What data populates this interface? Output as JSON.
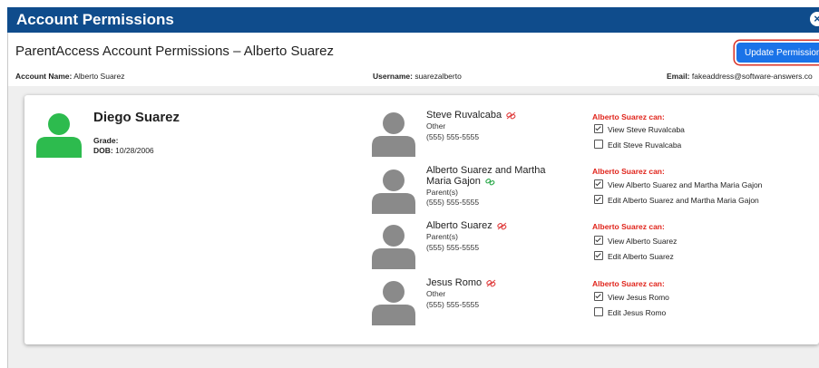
{
  "window": {
    "title": "Account Permissions"
  },
  "header": {
    "account_title": "ParentAccess Account Permissions – Alberto Suarez",
    "update_button_label": "Update Permissions"
  },
  "account_info": {
    "account_name_label": "Account Name:",
    "account_name_value": "Alberto Suarez",
    "username_label": "Username:",
    "username_value": "suarezalberto",
    "email_label": "Email:",
    "email_value": "fakeaddress@software-answers.co"
  },
  "student": {
    "name": "Diego Suarez",
    "grade_label": "Grade:",
    "grade_value": "",
    "dob_label": "DOB:",
    "dob_value": "10/28/2006"
  },
  "guardians": [
    {
      "name_line1": "Steve Ruvalcaba",
      "name_line2": "",
      "relationship": "Other",
      "phone": "(555) 555-5555",
      "link_icon": "unlinked-icon",
      "can_label": "Alberto Suarez can:",
      "view_label": "View Steve Ruvalcaba",
      "view_checked": true,
      "edit_label": "Edit Steve Ruvalcaba",
      "edit_checked": false
    },
    {
      "name_line1": "Alberto Suarez and Martha",
      "name_line2": "Maria Gajon",
      "relationship": "Parent(s)",
      "phone": "(555) 555-5555",
      "link_icon": "linked-icon",
      "can_label": "Alberto Suarez can:",
      "view_label": "View Alberto Suarez and Martha Maria Gajon",
      "view_checked": true,
      "edit_label": "Edit Alberto Suarez and Martha Maria Gajon",
      "edit_checked": true
    },
    {
      "name_line1": "Alberto Suarez",
      "name_line2": "",
      "relationship": "Parent(s)",
      "phone": "(555) 555-5555",
      "link_icon": "unlinked-icon",
      "can_label": "Alberto Suarez can:",
      "view_label": "View Alberto Suarez",
      "view_checked": true,
      "edit_label": "Edit Alberto Suarez",
      "edit_checked": true
    },
    {
      "name_line1": "Jesus Romo",
      "name_line2": "",
      "relationship": "Other",
      "phone": "(555) 555-5555",
      "link_icon": "unlinked-icon",
      "can_label": "Alberto Suarez can:",
      "view_label": "View Jesus Romo",
      "view_checked": true,
      "edit_label": "Edit Jesus Romo",
      "edit_checked": false
    }
  ],
  "colors": {
    "title_bar": "#0f4c8c",
    "button": "#1a73e8",
    "student_avatar": "#2dbb4e",
    "guardian_avatar": "#8a8a8a",
    "can_label": "#e0241b",
    "linked": "#2aa84a",
    "unlinked": "#e04040"
  }
}
